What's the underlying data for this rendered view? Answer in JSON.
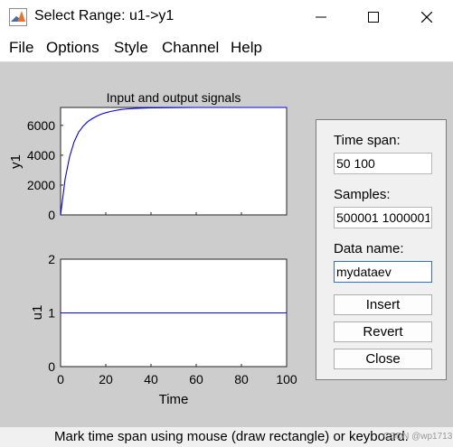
{
  "window": {
    "title": "Select Range: u1->y1"
  },
  "menu": [
    "File",
    "Options",
    "Style",
    "Channel",
    "Help"
  ],
  "top_axes": {
    "title": "Input and output signals",
    "ylabel": "y1",
    "yticks": [
      "0",
      "2000",
      "4000",
      "6000"
    ]
  },
  "bottom_axes": {
    "ylabel": "u1",
    "xlabel": "Time",
    "yticks": [
      "0",
      "1",
      "2"
    ],
    "xticks": [
      "0",
      "20",
      "40",
      "60",
      "80",
      "100"
    ]
  },
  "panel": {
    "time_span_label": "Time span:",
    "time_span_value": "50 100",
    "samples_label": "Samples:",
    "samples_value": "500001 1000001",
    "data_name_label": "Data name:",
    "data_name_value": "mydataev",
    "insert_button": "Insert",
    "revert_button": "Revert",
    "close_button": "Close"
  },
  "status": {
    "text": "Mark time span using mouse (draw rectangle) or keyboard.",
    "watermark": "CSDN @wp1713..."
  },
  "chart_data": [
    {
      "type": "line",
      "title": "Input and output signals",
      "xlabel": "",
      "ylabel": "y1",
      "xlim": [
        0,
        100
      ],
      "ylim": [
        0,
        7200
      ],
      "yticks": [
        0,
        2000,
        4000,
        6000
      ],
      "series": [
        {
          "color": "#0000ff",
          "x": [
            0,
            2,
            4,
            6,
            8,
            10,
            12,
            14,
            16,
            18,
            20,
            22,
            24,
            26,
            28,
            30,
            35,
            40,
            50,
            60,
            80,
            100
          ],
          "y": [
            0,
            2400,
            3900,
            4900,
            5550,
            5950,
            6250,
            6450,
            6620,
            6750,
            6850,
            6930,
            6990,
            7040,
            7080,
            7110,
            7150,
            7170,
            7190,
            7200,
            7200,
            7200
          ]
        }
      ]
    },
    {
      "type": "line",
      "title": "",
      "xlabel": "Time",
      "ylabel": "u1",
      "xlim": [
        0,
        100
      ],
      "ylim": [
        0,
        2
      ],
      "xticks": [
        0,
        20,
        40,
        60,
        80,
        100
      ],
      "yticks": [
        0,
        1,
        2
      ],
      "series": [
        {
          "color": "#0000ff",
          "x": [
            0,
            100
          ],
          "y": [
            1,
            1
          ]
        }
      ]
    }
  ]
}
